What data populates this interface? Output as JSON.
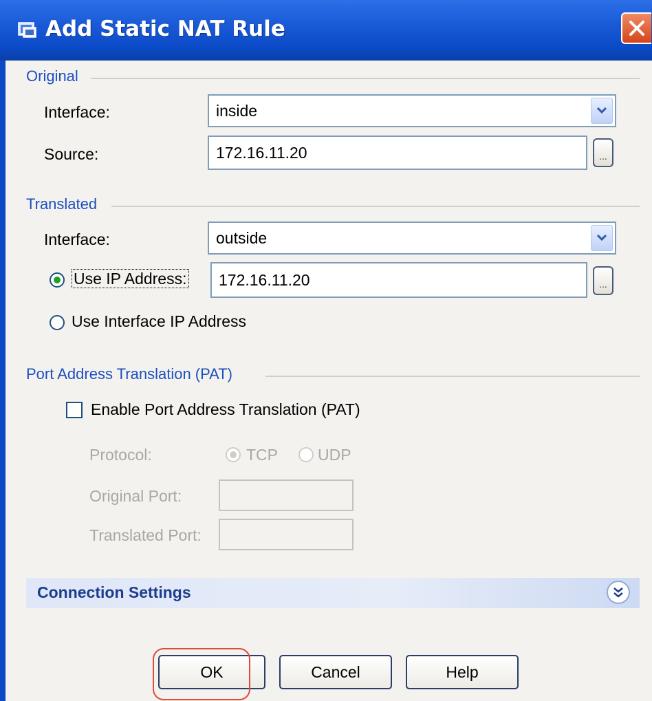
{
  "window": {
    "title": "Add Static NAT Rule",
    "close_icon": "close-icon",
    "accent_color": "#0b4ac6"
  },
  "original": {
    "group_label": "Original",
    "interface_label": "Interface:",
    "interface_value": "inside",
    "source_label": "Source:",
    "source_value": "172.16.11.20",
    "browse_label": "..."
  },
  "translated": {
    "group_label": "Translated",
    "interface_label": "Interface:",
    "interface_value": "outside",
    "use_ip_label": "Use IP Address:",
    "use_ip_checked": true,
    "use_ip_value": "172.16.11.20",
    "browse_label": "...",
    "use_interface_ip_label": "Use Interface IP Address",
    "use_interface_ip_checked": false
  },
  "pat": {
    "group_label": "Port Address Translation (PAT)",
    "enable_label": "Enable Port Address Translation (PAT)",
    "enable_checked": false,
    "protocol_label": "Protocol:",
    "tcp_label": "TCP",
    "udp_label": "UDP",
    "original_port_label": "Original Port:",
    "translated_port_label": "Translated Port:"
  },
  "connection_settings": {
    "label": "Connection Settings",
    "toggle_icon": "double-chevron-down-icon"
  },
  "buttons": {
    "ok": "OK",
    "cancel": "Cancel",
    "help": "Help"
  }
}
